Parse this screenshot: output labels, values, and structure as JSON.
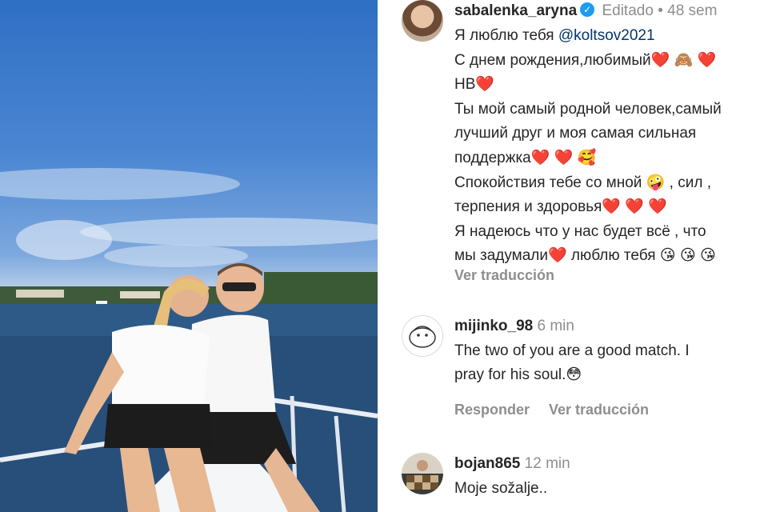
{
  "post": {
    "author": {
      "username": "sabalenka_aryna",
      "edited_label": "Editado",
      "separator": "•",
      "time": "48 sem"
    },
    "caption_lines": [
      {
        "parts": [
          {
            "text": "Я люблю тебя "
          },
          {
            "text": "@koltsov2021",
            "link": true
          }
        ]
      },
      {
        "parts": [
          {
            "text": "С днем рождения,любимый"
          },
          {
            "text": "❤️",
            "heart": true
          },
          {
            "text": " 🙈 "
          },
          {
            "text": "❤️",
            "heart": true
          }
        ]
      },
      {
        "parts": [
          {
            "text": "НВ"
          },
          {
            "text": "❤️",
            "heart": true
          }
        ]
      },
      {
        "parts": [
          {
            "text": "Ты мой самый родной человек,самый"
          }
        ]
      },
      {
        "parts": [
          {
            "text": "лучший друг и моя самая сильная"
          }
        ]
      },
      {
        "parts": [
          {
            "text": "поддержка"
          },
          {
            "text": "❤️",
            "heart": true
          },
          {
            "text": " "
          },
          {
            "text": "❤️",
            "heart": true
          },
          {
            "text": " 🥰"
          }
        ]
      },
      {
        "parts": [
          {
            "text": "Спокойствия тебе со мной "
          },
          {
            "text": "🤪"
          },
          {
            "text": " , сил ,"
          }
        ]
      },
      {
        "parts": [
          {
            "text": "терпения и здоровья"
          },
          {
            "text": "❤️",
            "heart": true
          },
          {
            "text": " "
          },
          {
            "text": "❤️",
            "heart": true
          },
          {
            "text": " "
          },
          {
            "text": "❤️",
            "heart": true
          }
        ]
      },
      {
        "parts": [
          {
            "text": "Я надеюсь что у нас будет всё , что"
          }
        ]
      },
      {
        "parts": [
          {
            "text": "мы задумали"
          },
          {
            "text": "❤️",
            "heart": true
          },
          {
            "text": " люблю тебя "
          },
          {
            "text": "😘 😘 😘"
          }
        ]
      }
    ],
    "see_translation": "Ver traducción"
  },
  "comments": [
    {
      "username": "mijinko_98",
      "time": "6 min",
      "lines": [
        "The two of you are a good match. I",
        "pray for his soul.😳"
      ],
      "reply_label": "Responder",
      "translate_label": "Ver traducción"
    },
    {
      "username": "bojan865",
      "time": "12 min",
      "lines": [
        "Moje sožalje.."
      ]
    }
  ],
  "colors": {
    "text": "#262626",
    "muted": "#8e8e8e",
    "link": "#00376b",
    "heart": "#e0245e",
    "verified": "#1d9bf0"
  },
  "icons": {
    "verified": "verified-badge-icon"
  }
}
